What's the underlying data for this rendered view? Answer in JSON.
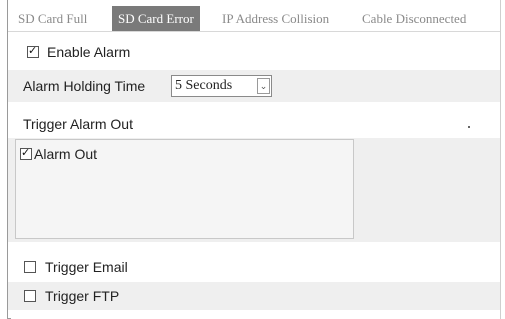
{
  "tabs": [
    {
      "label": "SD Card Full",
      "active": false
    },
    {
      "label": "SD Card Error",
      "active": true
    },
    {
      "label": "IP Address Collision",
      "active": false
    },
    {
      "label": "Cable Disconnected",
      "active": false
    }
  ],
  "enable_alarm": {
    "label": "Enable Alarm",
    "checked": true
  },
  "alarm_holding": {
    "label": "Alarm Holding Time",
    "value": "5 Seconds"
  },
  "trigger_alarm_out": {
    "label": "Trigger Alarm Out",
    "items": [
      {
        "label": "Alarm Out",
        "checked": true
      }
    ]
  },
  "trigger_email": {
    "label": "Trigger Email",
    "checked": false
  },
  "trigger_ftp": {
    "label": "Trigger FTP",
    "checked": false
  },
  "colors": {
    "active_tab": "#7a7a7a",
    "shaded_row": "#efefef"
  }
}
